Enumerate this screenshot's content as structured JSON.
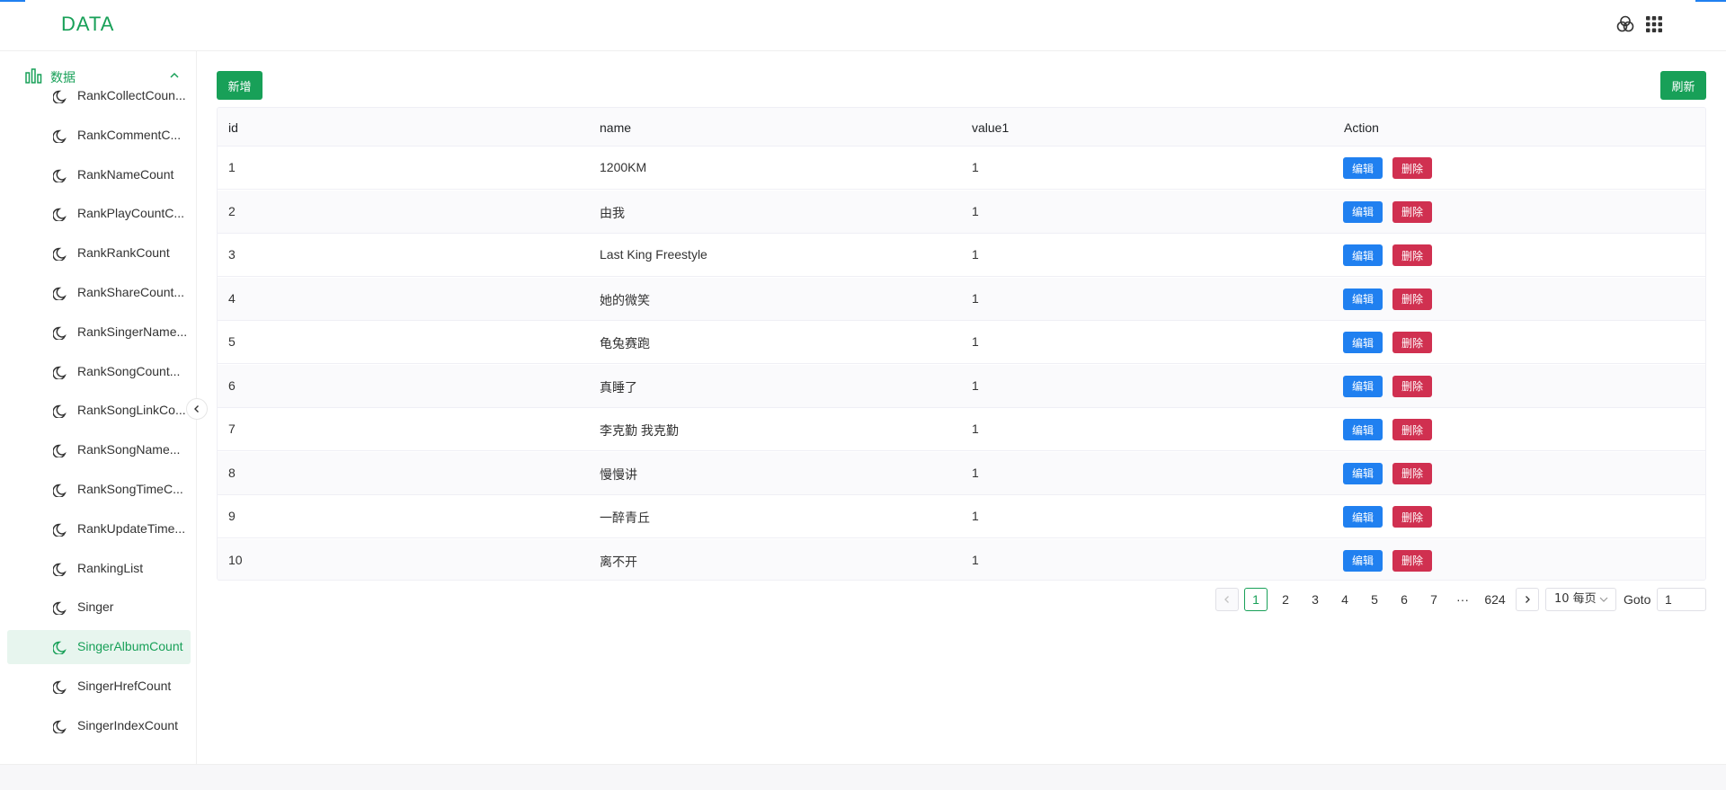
{
  "header": {
    "logo": "DATA"
  },
  "sidebar": {
    "group_label": "数据",
    "items": [
      {
        "label": "RankCollectCoun..."
      },
      {
        "label": "RankCommentC..."
      },
      {
        "label": "RankNameCount"
      },
      {
        "label": "RankPlayCountC..."
      },
      {
        "label": "RankRankCount"
      },
      {
        "label": "RankShareCount..."
      },
      {
        "label": "RankSingerName..."
      },
      {
        "label": "RankSongCount..."
      },
      {
        "label": "RankSongLinkCo..."
      },
      {
        "label": "RankSongName..."
      },
      {
        "label": "RankSongTimeC..."
      },
      {
        "label": "RankUpdateTime..."
      },
      {
        "label": "RankingList"
      },
      {
        "label": "Singer"
      },
      {
        "label": "SingerAlbumCount",
        "active": true
      },
      {
        "label": "SingerHrefCount"
      },
      {
        "label": "SingerIndexCount"
      }
    ]
  },
  "toolbar": {
    "add_label": "新增",
    "refresh_label": "刷新"
  },
  "table": {
    "columns": [
      "id",
      "name",
      "value1",
      "Action"
    ],
    "edit_label": "编辑",
    "delete_label": "删除",
    "rows": [
      {
        "id": "1",
        "name": "1200KM",
        "value1": "1"
      },
      {
        "id": "2",
        "name": "由我",
        "value1": "1"
      },
      {
        "id": "3",
        "name": "Last King Freestyle",
        "value1": "1"
      },
      {
        "id": "4",
        "name": "她的微笑",
        "value1": "1"
      },
      {
        "id": "5",
        "name": "龟兔赛跑",
        "value1": "1"
      },
      {
        "id": "6",
        "name": "真睡了",
        "value1": "1"
      },
      {
        "id": "7",
        "name": "李克勤 我克勤",
        "value1": "1"
      },
      {
        "id": "8",
        "name": "慢慢讲",
        "value1": "1"
      },
      {
        "id": "9",
        "name": "一醉青丘",
        "value1": "1"
      },
      {
        "id": "10",
        "name": "离不开",
        "value1": "1"
      }
    ]
  },
  "pagination": {
    "pages": [
      "1",
      "2",
      "3",
      "4",
      "5",
      "6",
      "7",
      "···",
      "624"
    ],
    "current": "1",
    "page_size": "10 每页",
    "goto_label": "Goto",
    "goto_value": "1"
  },
  "colors": {
    "primary": "#18a058",
    "info": "#2080f0",
    "error": "#d03050"
  }
}
